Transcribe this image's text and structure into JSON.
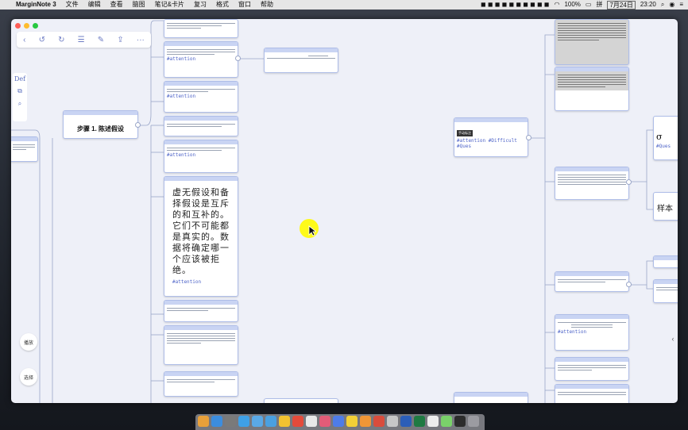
{
  "menubar": {
    "app_name": "MarginNote 3",
    "items": [
      "文件",
      "编辑",
      "查看",
      "脑图",
      "笔记&卡片",
      "复习",
      "格式",
      "窗口",
      "帮助"
    ],
    "battery": "100%",
    "input_method": "拼",
    "date": "7月24日",
    "time": "23:20"
  },
  "toolbar": {
    "icons": [
      "chevron-left-icon",
      "undo-icon",
      "redo-icon",
      "list-icon",
      "edit-icon",
      "share-icon",
      "more-icon"
    ]
  },
  "sidetools": {
    "def_label": "Def"
  },
  "side_buttons": {
    "play_label": "播放",
    "select_label": "选择"
  },
  "mindmap": {
    "root_title": "步骤 1.   陈述假设",
    "tags": {
      "attention": "#attention",
      "difficult": "#Difficult",
      "ques": "#Ques"
    },
    "big_card_text": "虚无假设和备择假设是互斥的和互补的。它们不可能都是真实的。数据将确定哪一个应该被拒绝。",
    "right_big_symbol": "σ",
    "right_label": "样本",
    "mid_card_badge": "手动标注"
  },
  "colors": {
    "canvas_bg": "#eef0f8",
    "accent": "#4d63c8",
    "card_border": "#aebde8",
    "cursor_highlight": "#fffb00"
  }
}
